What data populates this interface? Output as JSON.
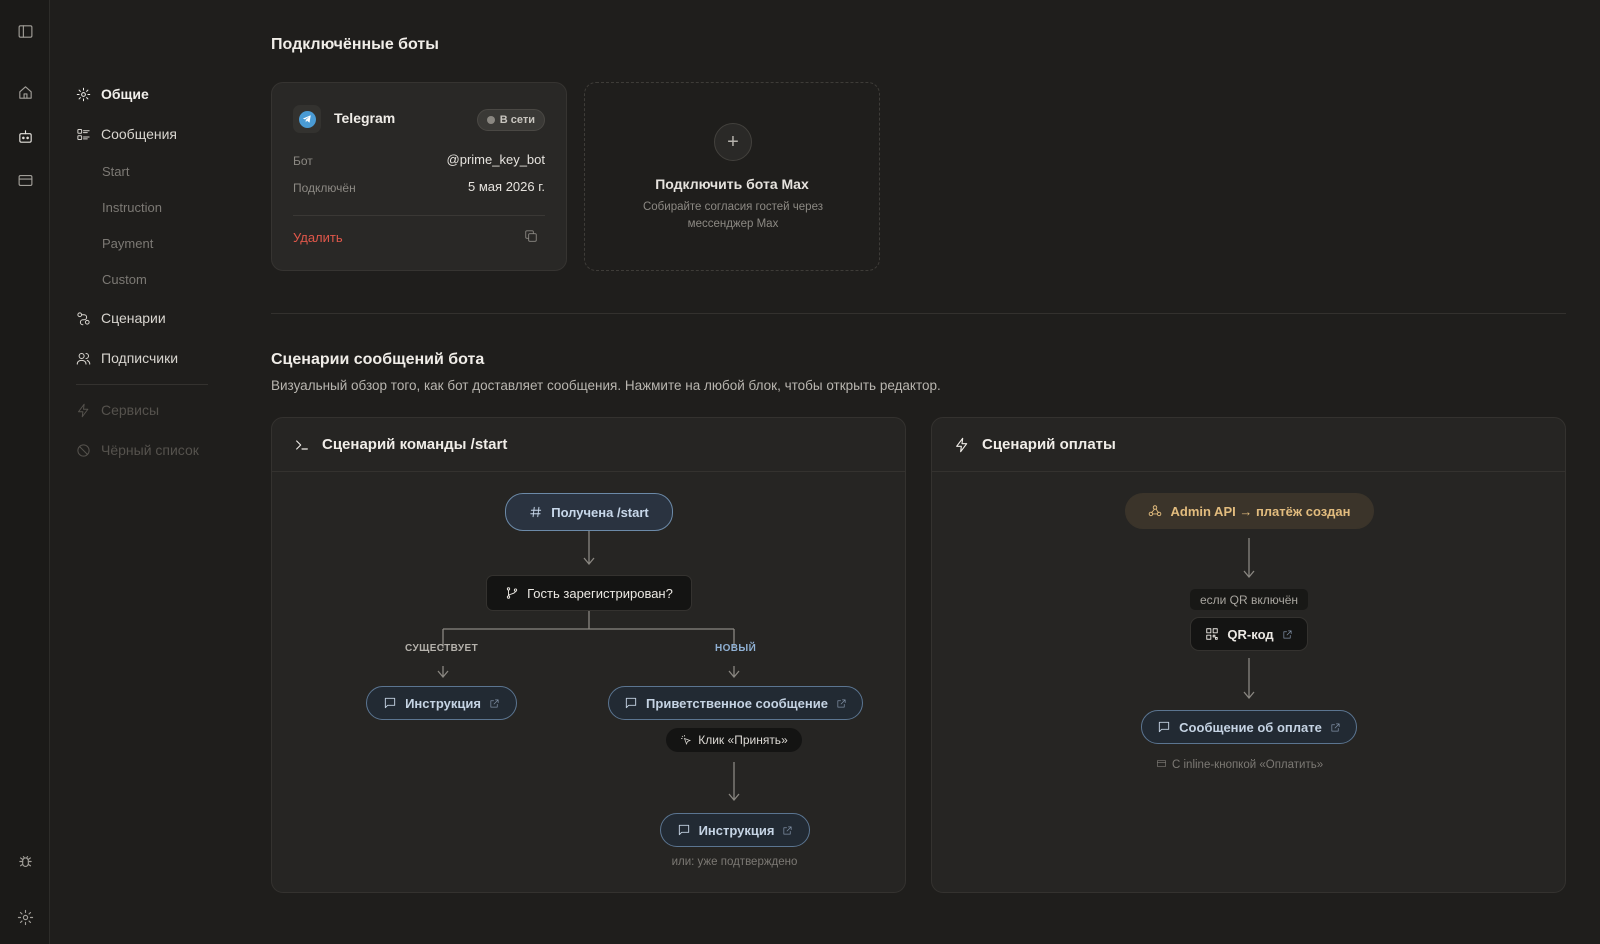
{
  "rail": {
    "icons": [
      "sidebar-toggle-icon",
      "home-icon",
      "bot-icon",
      "card-icon",
      "bug-icon",
      "gear-icon"
    ]
  },
  "nav": {
    "general": "Общие",
    "messages": "Сообщения",
    "sub": [
      "Start",
      "Instruction",
      "Payment",
      "Custom"
    ],
    "scenarios": "Сценарии",
    "subscribers": "Подписчики",
    "services": "Сервисы",
    "blacklist": "Чёрный список"
  },
  "bots": {
    "title": "Подключённые боты",
    "telegram": {
      "name": "Telegram",
      "status": "В сети",
      "bot_label": "Бот",
      "bot_value": "@prime_key_bot",
      "connected_label": "Подключён",
      "connected_value": "5 мая 2026 г.",
      "delete": "Удалить"
    },
    "add": {
      "title": "Подключить бота Max",
      "desc": "Собирайте согласия гостей через мессенджер Max"
    }
  },
  "scenarios": {
    "title": "Сценарии сообщений бота",
    "subtitle": "Визуальный обзор того, как бот доставляет сообщения. Нажмите на любой блок, чтобы открыть редактор.",
    "start": {
      "title": "Сценарий команды /start",
      "received": "Получена /start",
      "question": "Гость зарегистрирован?",
      "exists": "существует",
      "new": "новый",
      "instruction": "Инструкция",
      "welcome": "Приветственное сообщение",
      "click": "Клик «Принять»",
      "instruction2": "Инструкция",
      "or_note": "или: уже подтверждено"
    },
    "payment": {
      "title": "Сценарий оплаты",
      "trigger": "Admin API → платёж создан",
      "condition": "если QR включён",
      "qr": "QR-код",
      "message": "Сообщение об оплате",
      "inline_note": "С inline-кнопкой «Оплатить»"
    }
  },
  "colors": {
    "background": "#1f1e1c",
    "accent_blue": "#6c8aa8",
    "amber": "#e2bc7e",
    "danger": "#e0574a",
    "telegram": "#4a9bd4"
  }
}
